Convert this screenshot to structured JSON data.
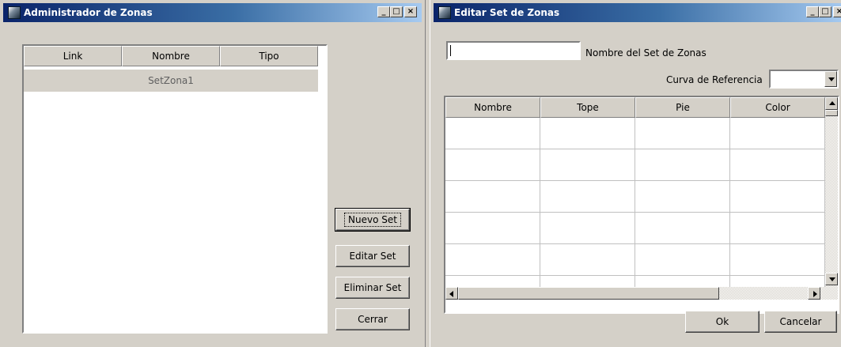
{
  "win1": {
    "title": "Administrador de Zonas",
    "columns": [
      "Link",
      "Nombre",
      "Tipo"
    ],
    "rows": [
      {
        "link": "",
        "nombre": "SetZona1",
        "tipo": ""
      }
    ],
    "buttons": {
      "nuevo": "Nuevo Set",
      "editar": "Editar Set",
      "eliminar": "Eliminar Set",
      "cerrar": "Cerrar"
    }
  },
  "win2": {
    "title": "Editar Set de Zonas",
    "name_label": "Nombre del Set de Zonas",
    "name_value": "",
    "curve_label": "Curva de Referencia",
    "curve_value": "",
    "columns": [
      "Nombre",
      "Tope",
      "Pie",
      "Color"
    ],
    "buttons": {
      "ok": "Ok",
      "cancelar": "Cancelar"
    }
  },
  "titlebar_buttons": {
    "minimize": "_",
    "maximize": "□",
    "close": "×"
  },
  "colors": {
    "titlebar_start": "#0a246a",
    "titlebar_end": "#a6caf0",
    "face": "#d4d0c8",
    "row_selected": "#d4d0c8"
  }
}
